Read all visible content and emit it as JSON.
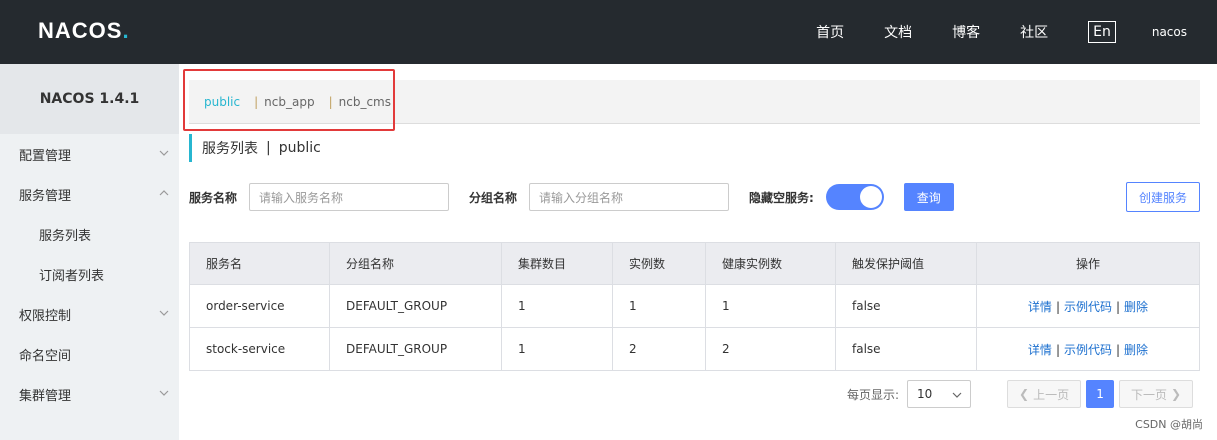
{
  "header": {
    "logo_text": "NACOS",
    "logo_dot": ".",
    "nav": [
      "首页",
      "文档",
      "博客",
      "社区"
    ],
    "lang": "En",
    "user": "nacos"
  },
  "sidebar": {
    "title": "NACOS 1.4.1",
    "items": [
      {
        "label": "配置管理"
      },
      {
        "label": "服务管理"
      },
      {
        "label": "服务列表"
      },
      {
        "label": "订阅者列表"
      },
      {
        "label": "权限控制"
      },
      {
        "label": "命名空间"
      },
      {
        "label": "集群管理"
      }
    ]
  },
  "namespaces": [
    "public",
    "ncb_app",
    "ncb_cms"
  ],
  "namespace_separator": "|",
  "page": {
    "title": "服务列表",
    "separator": "|",
    "namespace": "public"
  },
  "filters": {
    "service_name_label": "服务名称",
    "service_name_placeholder": "请输入服务名称",
    "group_name_label": "分组名称",
    "group_name_placeholder": "请输入分组名称",
    "hide_empty_label": "隐藏空服务:",
    "query_label": "查询",
    "create_label": "创建服务"
  },
  "table": {
    "headers": [
      "服务名",
      "分组名称",
      "集群数目",
      "实例数",
      "健康实例数",
      "触发保护阈值",
      "操作"
    ],
    "rows": [
      [
        "order-service",
        "DEFAULT_GROUP",
        "1",
        "1",
        "1",
        "false"
      ],
      [
        "stock-service",
        "DEFAULT_GROUP",
        "1",
        "2",
        "2",
        "false"
      ]
    ],
    "ops": [
      "详情",
      "示例代码",
      "删除"
    ],
    "op_separator": "|"
  },
  "pagination": {
    "page_size_label": "每页显示:",
    "page_size": "10",
    "prev": "上一页",
    "next": "下一页",
    "current": "1"
  },
  "watermark": "CSDN @胡尚",
  "colors": {
    "header_bg": "#252a2f",
    "accent": "#27b6d0",
    "primary": "#5584ff",
    "highlight_border": "#e23a3a"
  }
}
